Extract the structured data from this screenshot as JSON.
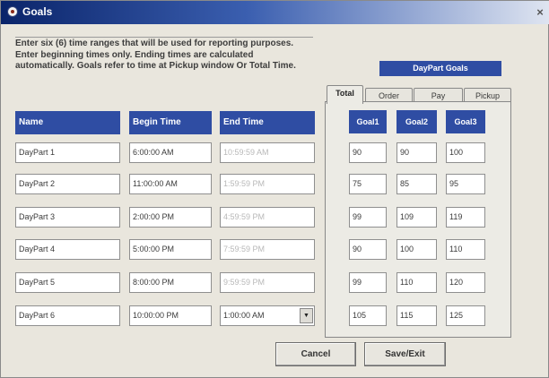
{
  "window": {
    "title": "Goals",
    "close_glyph": "×"
  },
  "instructions": "Enter six (6) time ranges that will be used for reporting purposes.  Enter beginning times only.  Ending times are calculated automatically. Goals refer to time at Pickup window Or Total Time.",
  "columns": {
    "name": "Name",
    "begin": "Begin Time",
    "end": "End Time"
  },
  "dayparts": [
    {
      "name": "DayPart 1",
      "begin": "6:00:00 AM",
      "end": "10:59:59 AM"
    },
    {
      "name": "DayPart 2",
      "begin": "11:00:00 AM",
      "end": "1:59:59 PM"
    },
    {
      "name": "DayPart 3",
      "begin": "2:00:00 PM",
      "end": "4:59:59 PM"
    },
    {
      "name": "DayPart 4",
      "begin": "5:00:00 PM",
      "end": "7:59:59 PM"
    },
    {
      "name": "DayPart 5",
      "begin": "8:00:00 PM",
      "end": "9:59:59 PM"
    },
    {
      "name": "DayPart 6",
      "begin": "10:00:00 PM",
      "end": "1:00:00 AM"
    }
  ],
  "goals_panel": {
    "badge": "DayPart Goals",
    "tabs": [
      "Total",
      "Order",
      "Pay",
      "Pickup"
    ],
    "active_tab": "Total",
    "headers": [
      "Goal1",
      "Goal2",
      "Goal3"
    ],
    "rows": [
      [
        "90",
        "90",
        "100"
      ],
      [
        "75",
        "85",
        "95"
      ],
      [
        "99",
        "109",
        "119"
      ],
      [
        "90",
        "100",
        "110"
      ],
      [
        "99",
        "110",
        "120"
      ],
      [
        "105",
        "115",
        "125"
      ]
    ]
  },
  "buttons": {
    "cancel": "Cancel",
    "save_exit": "Save/Exit"
  },
  "colors": {
    "header_blue": "#2f4da3",
    "title_bar": "#0a246a"
  }
}
